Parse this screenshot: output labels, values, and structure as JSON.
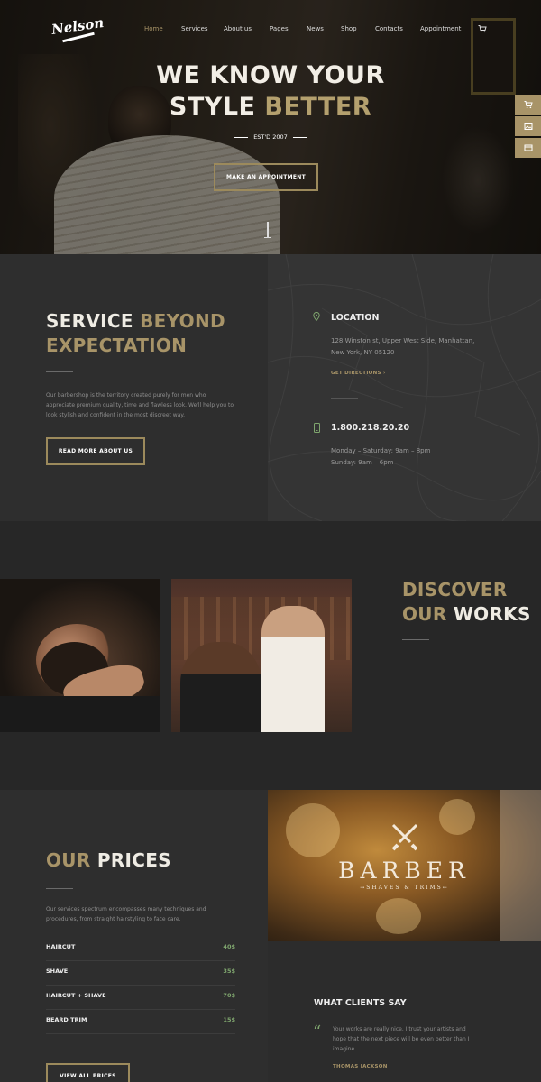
{
  "brand": {
    "logo_text": "Nelson"
  },
  "nav": {
    "items": [
      "Home",
      "Services",
      "About us",
      "Pages",
      "News",
      "Shop",
      "Contacts",
      "Appointment"
    ],
    "active_index": 0
  },
  "hero": {
    "title_line1": "WE KNOW YOUR",
    "title_line2_a": "STYLE ",
    "title_line2_b": "BETTER",
    "est": "EST'D 2007",
    "cta": "MAKE AN APPOINTMENT"
  },
  "service": {
    "title_a": "SERVICE ",
    "title_b": "BEYOND",
    "title_c": "EXPECTATION",
    "text": "Our barbershop is the territory created purely for men who appreciate premium quality, time and flawless look. We'll help you to look stylish and confident in the most discreet way.",
    "button": "READ MORE ABOUT US",
    "location_label": "LOCATION",
    "address": "128 Winston st, Upper West Side, Manhattan, New York, NY 05120",
    "directions": "GET DIRECTIONS",
    "phone": "1.800.218.20.20",
    "hours_weekday": "Monday – Saturday: 9am – 8pm",
    "hours_sunday": "Sunday: 9am – 6pm"
  },
  "works": {
    "title_a": "DISCOVER",
    "title_b": "OUR ",
    "title_c": "WORKS"
  },
  "prices": {
    "title_a": "OUR ",
    "title_b": "PRICES",
    "text": "Our services spectrum encompasses many techniques and procedures, from straight hairstyling to face care.",
    "items": [
      {
        "name": "HAIRCUT",
        "price": "40$"
      },
      {
        "name": "SHAVE",
        "price": "35$"
      },
      {
        "name": "HAIRCUT + SHAVE",
        "price": "70$"
      },
      {
        "name": "BEARD TRIM",
        "price": "15$"
      }
    ],
    "button": "VIEW ALL PRICES"
  },
  "barber_sign": {
    "word": "BARBER",
    "sub": "SHAVES & TRIMS"
  },
  "testimonial": {
    "heading": "WHAT CLIENTS SAY",
    "quote_mark": "“",
    "text": "Your works are really nice. I trust your artists and hope that the next piece will be even better than I imagine.",
    "author": "THOMAS JACKSON"
  },
  "colors": {
    "gold": "#a89468",
    "price_green": "#7fa66e",
    "dark": "#2e2e2e"
  },
  "icons": [
    "cart-icon",
    "map-pin-icon",
    "phone-icon",
    "arrow-left-icon",
    "arrow-right-icon",
    "quote-icon"
  ]
}
